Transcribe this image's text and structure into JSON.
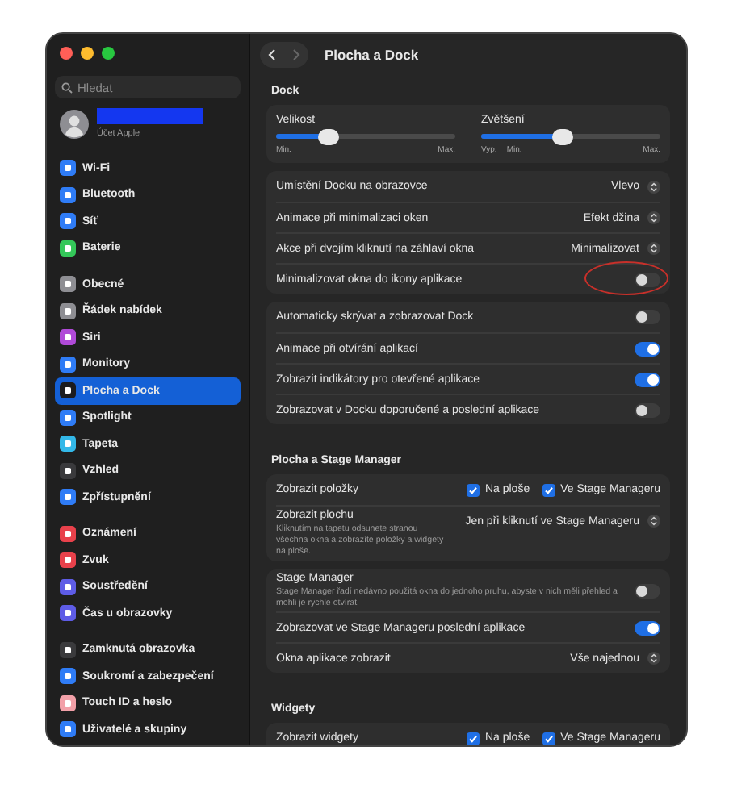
{
  "window": {
    "title": "Plocha a Dock",
    "nav": [
      {
        "kind": "back",
        "disabled": false
      },
      {
        "kind": "forward",
        "disabled": true
      }
    ]
  },
  "sidebar": {
    "search": {
      "placeholder": "Hledat"
    },
    "account": {
      "subtitle": "Účet Apple"
    },
    "groups": [
      [
        {
          "label": "Wi-Fi",
          "color": "#2f7cf6",
          "selected": false
        },
        {
          "label": "Bluetooth",
          "color": "#2f7cf6",
          "selected": false
        },
        {
          "label": "Síť",
          "color": "#2f7cf6",
          "selected": false
        },
        {
          "label": "Baterie",
          "color": "#34c759",
          "selected": false
        }
      ],
      [
        {
          "label": "Obecné",
          "color": "#8e8e93",
          "selected": false
        },
        {
          "label": "Řádek nabídek",
          "color": "#8e8e93",
          "selected": false
        },
        {
          "label": "Siri",
          "color": "#b04ad8",
          "selected": false
        },
        {
          "label": "Monitory",
          "color": "#2f7cf6",
          "selected": false
        },
        {
          "label": "Plocha a Dock",
          "color": "#1c1c1e",
          "selected": true
        },
        {
          "label": "Spotlight",
          "color": "#2f7cf6",
          "selected": false
        },
        {
          "label": "Tapeta",
          "color": "#33b8e8",
          "selected": false
        },
        {
          "label": "Vzhled",
          "color": "#3a3a3c",
          "selected": false
        },
        {
          "label": "Zpřístupnění",
          "color": "#2f7cf6",
          "selected": false
        }
      ],
      [
        {
          "label": "Oznámení",
          "color": "#e8414b",
          "selected": false
        },
        {
          "label": "Zvuk",
          "color": "#e8414b",
          "selected": false
        },
        {
          "label": "Soustředění",
          "color": "#5e5ce6",
          "selected": false
        },
        {
          "label": "Čas u obrazovky",
          "color": "#5e5ce6",
          "selected": false
        }
      ],
      [
        {
          "label": "Zamknutá obrazovka",
          "color": "#3a3a3c",
          "selected": false
        },
        {
          "label": "Soukromí a zabezpečení",
          "color": "#2f7cf6",
          "selected": false
        },
        {
          "label": "Touch ID a heslo",
          "color": "#f2a0a8",
          "selected": false
        },
        {
          "label": "Uživatelé a skupiny",
          "color": "#2f7cf6",
          "selected": false
        }
      ]
    ]
  },
  "sections": [
    {
      "title": "Dock",
      "groups": [
        [
          {
            "kind": "sliders",
            "sliders": [
              {
                "label": "Velikost",
                "level": 0.29,
                "ticks": [
                  "Min.",
                  "Max."
                ]
              },
              {
                "label": "Zvětšení",
                "level": 0.45,
                "ticks": [
                  "Vyp.",
                  "Min.",
                  "Max."
                ]
              }
            ]
          }
        ],
        [
          {
            "kind": "popup",
            "label": "Umístění Docku na obrazovce",
            "value": "Vlevo"
          },
          {
            "kind": "popup",
            "label": "Animace při minimalizaci oken",
            "value": "Efekt džina"
          },
          {
            "kind": "popup",
            "label": "Akce při dvojím kliknutí na záhlaví okna",
            "value": "Minimalizovat"
          },
          {
            "kind": "toggle",
            "label": "Minimalizovat okna do ikony aplikace",
            "on": false,
            "circled": true
          }
        ],
        [
          {
            "kind": "toggle",
            "label": "Automaticky skrývat a zobrazovat Dock",
            "on": false,
            "circled": false
          },
          {
            "kind": "toggle",
            "label": "Animace při otvírání aplikací",
            "on": true,
            "circled": false
          },
          {
            "kind": "toggle",
            "label": "Zobrazit indikátory pro otevřené aplikace",
            "on": true,
            "circled": false
          },
          {
            "kind": "toggle",
            "label": "Zobrazovat v Docku doporučené a poslední aplikace",
            "on": false,
            "circled": false
          }
        ]
      ]
    },
    {
      "title": "Plocha a Stage Manager",
      "groups": [
        [
          {
            "kind": "checks",
            "label": "Zobrazit položky",
            "options": [
              {
                "label": "Na ploše",
                "checked": true
              },
              {
                "label": "Ve Stage Manageru",
                "checked": true
              }
            ]
          },
          {
            "kind": "popup",
            "label": "Zobrazit plochu",
            "value": "Jen při kliknutí ve Stage Manageru",
            "description": "Kliknutím na tapetu odsunete stranou všechna okna a zobrazíte položky a widgety na ploše."
          }
        ],
        [
          {
            "kind": "toggle",
            "label": "Stage Manager",
            "on": false,
            "circled": false,
            "description": "Stage Manager řadí nedávno použitá okna do jednoho pruhu, abyste v nich měli přehled a mohli je rychle otvírat."
          },
          {
            "kind": "toggle",
            "label": "Zobrazovat ve Stage Manageru poslední aplikace",
            "on": true,
            "circled": false
          },
          {
            "kind": "popup",
            "label": "Okna aplikace zobrazit",
            "value": "Vše najednou"
          }
        ]
      ]
    },
    {
      "title": "Widgety",
      "groups": [
        [
          {
            "kind": "checks",
            "label": "Zobrazit widgety",
            "options": [
              {
                "label": "Na ploše",
                "checked": true
              },
              {
                "label": "Ve Stage Manageru",
                "checked": true
              }
            ]
          }
        ]
      ]
    }
  ]
}
